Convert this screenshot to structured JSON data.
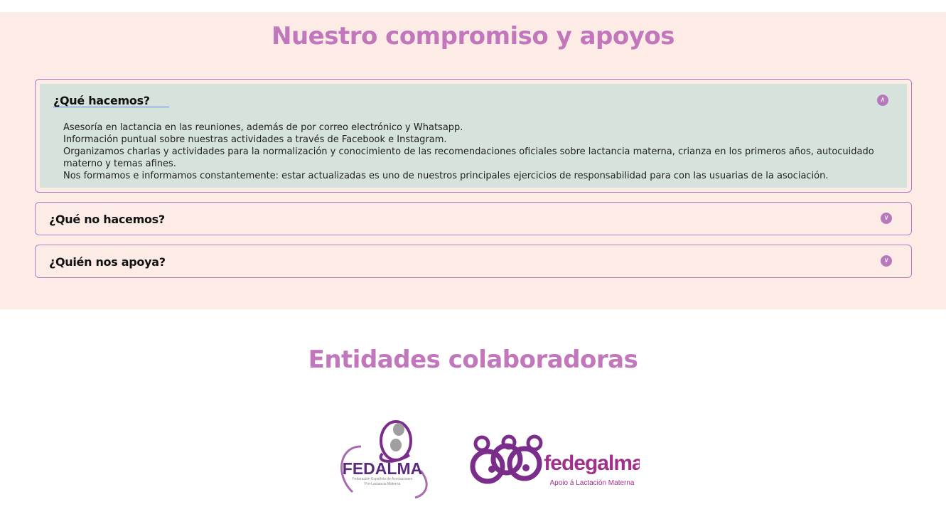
{
  "section_commitment": {
    "title": "Nuestro compromiso y apoyos",
    "accordion": [
      {
        "heading": "¿Qué hacemos?",
        "expanded": true,
        "lines": [
          "Asesoría en lactancia en las reuniones, además de por correo electrónico y Whatsapp.",
          "Información puntual sobre nuestras actividades a través de Facebook e Instagram.",
          "Organizamos charlas y actividades para la normalización y conocimiento de las recomendaciones oficiales sobre lactancia materna, crianza en los primeros años, autocuidado materno y temas afines.",
          "Nos formamos e informamos constantemente: estar actualizadas es uno de nuestros principales ejercicios de responsabilidad para con las usuarias de la asociación."
        ]
      },
      {
        "heading": "¿Qué no hacemos?",
        "expanded": false
      },
      {
        "heading": "¿Quién nos apoya?",
        "expanded": false
      }
    ]
  },
  "section_partners": {
    "title": "Entidades colaboradoras",
    "logos": [
      {
        "name": "FEDALMA",
        "subtitle_1": "Federación Española de Asociaciones",
        "subtitle_2": "Pro-Lactancia Materna"
      },
      {
        "name": "fedegalma",
        "subtitle": "Apoio á Lactación Materna"
      }
    ]
  },
  "colors": {
    "accent_title": "#c277bd",
    "section_bg": "#fdece6",
    "open_panel_bg": "#d6e2dc",
    "border": "#b27cc7",
    "logo_purple": "#7b2d8b",
    "logo_magenta": "#a0308e"
  },
  "icons": {
    "open": "chevron-up-icon",
    "closed": "chevron-down-icon"
  }
}
